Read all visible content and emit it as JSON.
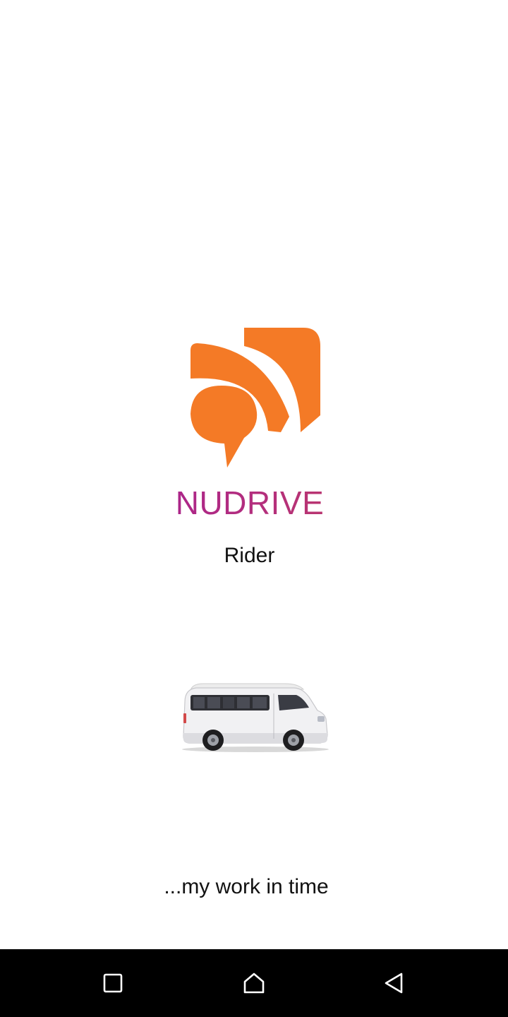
{
  "app": {
    "brand_name": "NUDRIVE",
    "subtitle": "Rider",
    "tagline": "...my work in time"
  },
  "icons": {
    "logo": "orange-chat-signal-logo-icon",
    "vehicle": "white-minivan-icon",
    "nav_recent": "square-recent-apps-icon",
    "nav_home": "home-icon",
    "nav_back": "triangle-back-icon"
  },
  "colors": {
    "logo_orange": "#f47a26",
    "brand_gradient_start": "#9c14a4",
    "brand_gradient_end": "#c8484e",
    "text": "#111111",
    "background": "#ffffff",
    "navbar": "#000000",
    "nav_icon": "#ffffff"
  }
}
